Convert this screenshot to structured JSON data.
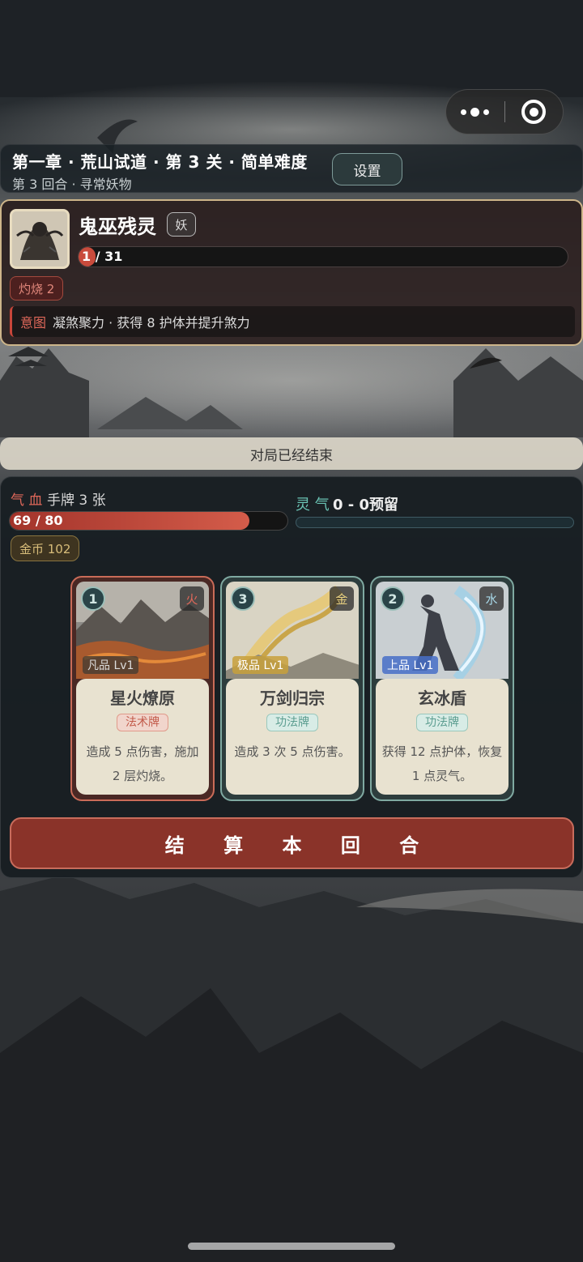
{
  "top_bar": {
    "menu_icon": "more-dots-icon",
    "close_icon": "target-circle-icon"
  },
  "header": {
    "title": "第一章 · 荒山试道 · 第 3 关 · 简单难度",
    "subtitle": "第 3 回合 · 寻常妖物",
    "settings_label": "设置"
  },
  "enemy": {
    "name": "鬼巫残灵",
    "tag": "妖",
    "hp_text": "1 / 31",
    "hp_current": 1,
    "hp_max": 31,
    "status": "灼烧 2",
    "intent_label": "意图",
    "intent_text": "凝煞聚力 · 获得 8 护体并提升煞力"
  },
  "banner": {
    "text": "对局已经结束"
  },
  "player": {
    "qx_label": "气 血",
    "hand_label": "手牌 3 张",
    "hp_text": "69 / 80",
    "hp_current": 69,
    "hp_max": 80,
    "coin_text": "金币 102",
    "lingqi_label": "灵 气",
    "lingqi_value": "0 - 0预留",
    "lingqi_fraction": 0
  },
  "cards": [
    {
      "cost": "1",
      "element": "火",
      "rarity": "凡品 Lv1",
      "name": "星火燎原",
      "type": "法术牌",
      "desc": "造成 5 点伤害，施加 2 层灼烧。"
    },
    {
      "cost": "3",
      "element": "金",
      "rarity": "极品 Lv1",
      "name": "万剑归宗",
      "type": "功法牌",
      "desc": "造成 3 次 5 点伤害。"
    },
    {
      "cost": "2",
      "element": "水",
      "rarity": "上品 Lv1",
      "name": "玄冰盾",
      "type": "功法牌",
      "desc": "获得 12 点护体，恢复 1 点灵气。"
    }
  ],
  "actions": {
    "settle_label": "结 算 本 回 合"
  },
  "colors": {
    "accent_red": "#8a3329",
    "hp_red": "#c94b3c",
    "lingqi_teal": "#6ac3b4",
    "gold_border": "#cdb58a"
  }
}
